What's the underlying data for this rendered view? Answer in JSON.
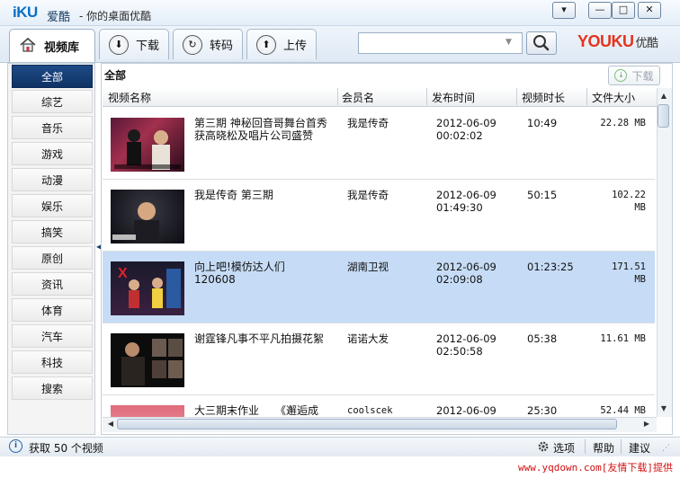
{
  "window": {
    "logo": "iKU",
    "app_name": "爱酷",
    "subtitle": "- 你的桌面优酷",
    "btn_menu": "▾",
    "btn_min": "—",
    "btn_max": "□",
    "btn_close": "✕"
  },
  "toolbar": {
    "tabs": [
      {
        "label": "视频库",
        "icon": "home-icon"
      },
      {
        "label": "下载",
        "icon": "download-icon"
      },
      {
        "label": "转码",
        "icon": "convert-icon"
      },
      {
        "label": "上传",
        "icon": "upload-icon"
      }
    ],
    "search_placeholder": "",
    "brand_en": "YOUKU",
    "brand_zh": "优酷"
  },
  "sidebar": {
    "items": [
      "全部",
      "综艺",
      "音乐",
      "游戏",
      "动漫",
      "娱乐",
      "搞笑",
      "原创",
      "资讯",
      "体育",
      "汽车",
      "科技",
      "搜索"
    ],
    "active_index": 0
  },
  "main": {
    "title": "全部",
    "download_label": "下载",
    "columns": [
      "视频名称",
      "会员名",
      "发布时间",
      "视频时长",
      "文件大小"
    ],
    "rows": [
      {
        "title": "第三期 神秘回音哥舞台首秀 获高晓松及唱片公司盛赞",
        "user": "我是传奇",
        "date": "2012-06-09",
        "time": "00:02:02",
        "duration": "10:49",
        "size": "22.28 MB",
        "selected": false
      },
      {
        "title": "我是传奇 第三期",
        "user": "我是传奇",
        "date": "2012-06-09",
        "time": "01:49:30",
        "duration": "50:15",
        "size": "102.22 MB",
        "selected": false
      },
      {
        "title": "向上吧!模仿达人们 120608",
        "user": "湖南卫视",
        "date": "2012-06-09",
        "time": "02:09:08",
        "duration": "01:23:25",
        "size": "171.51 MB",
        "selected": true
      },
      {
        "title": "谢霆锋凡事不平凡拍摄花絮",
        "user": "诺诺大发",
        "date": "2012-06-09",
        "time": "02:50:58",
        "duration": "05:38",
        "size": "11.61 MB",
        "selected": false
      },
      {
        "title": "大三期末作业　　《邂逅成",
        "user": "coolscek",
        "date": "2012-06-09",
        "time": "",
        "duration": "25:30",
        "size": "52.44 MB",
        "selected": false
      }
    ]
  },
  "status": {
    "text": "获取 50 个视频",
    "options": "选项",
    "help": "帮助",
    "suggest": "建议"
  },
  "credit": "www.yqdown.com[友情下载]提供"
}
